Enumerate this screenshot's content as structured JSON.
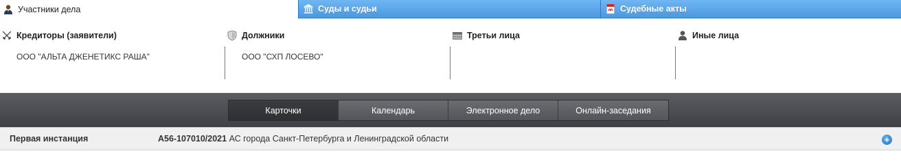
{
  "tabs": [
    {
      "label": "Участники дела",
      "icon": "person-icon",
      "active": true
    },
    {
      "label": "Суды и судьи",
      "icon": "courthouse-icon",
      "active": false
    },
    {
      "label": "Судебные акты",
      "icon": "pdf-document-icon",
      "active": false
    }
  ],
  "participants": {
    "creditors": {
      "title": "Кредиторы (заявители)",
      "icon": "crossed-swords-icon",
      "items": [
        "ООО \"АЛЬТА ДЖЕНЕТИКС РАША\""
      ]
    },
    "debtors": {
      "title": "Должники",
      "icon": "shield-icon",
      "items": [
        "ООО \"СХП ЛОСЕВО\""
      ]
    },
    "third_parties": {
      "title": "Третьи лица",
      "icon": "calendar-grid-icon",
      "items": []
    },
    "others": {
      "title": "Иные лица",
      "icon": "person-icon",
      "items": []
    }
  },
  "nav": {
    "buttons": [
      "Карточки",
      "Календарь",
      "Электронное дело",
      "Онлайн-заседания"
    ],
    "active_index": 0
  },
  "instance": {
    "label": "Первая инстанция",
    "case_number": "А56-107010/2021",
    "court": "АС города Санкт-Петербурга и Ленинградской области",
    "expand_icon": "plus-circle-icon"
  },
  "colors": {
    "tab_blue": "#4b98e0",
    "nav_dark": "#3e4045",
    "nav_active": "#2f3034",
    "instance_bg": "#f0f0f0",
    "plus_blue": "#1f6fc4"
  }
}
